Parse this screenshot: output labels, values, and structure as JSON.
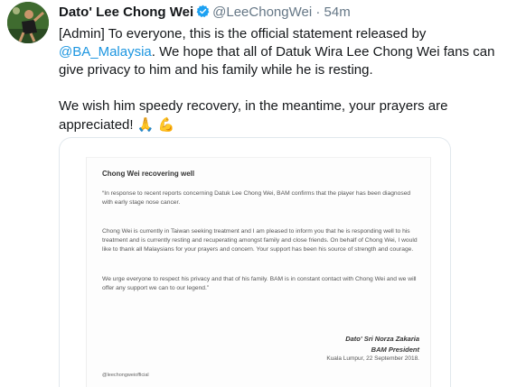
{
  "tweet": {
    "author": {
      "name": "Dato' Lee Chong Wei",
      "handle": "@LeeChongWei",
      "separator": "·",
      "time": "54m",
      "verified": true
    },
    "text": {
      "line1_prefix": "[Admin] To everyone, this is the official statement released by ",
      "mention": "@BA_Malaysia",
      "line1_suffix": ". We hope that all of Datuk Wira Lee Chong Wei fans can give privacy to him and his family while he is resting.",
      "line2": "We wish him speedy recovery, in the meantime, your prayers are appreciated!",
      "emoji_pray": "🙏",
      "emoji_muscle": "💪"
    }
  },
  "statement": {
    "title": "Chong Wei recovering well",
    "paragraph1": "“In response to recent reports concerning Datuk Lee Chong Wei, BAM confirms that the player has been diagnosed with early stage nose cancer.",
    "paragraph2": "Chong Wei is currently in Taiwan seeking treatment and I am pleased to inform you that he is responding well to his treatment and is currently resting and recuperating amongst family and close friends. On behalf of Chong Wei, I would like to thank all Malaysians for your prayers and concern. Your support has been his source of strength and courage.",
    "paragraph3": "We urge everyone to respect his privacy and that of his family. BAM is in constant contact with Chong Wei and we will offer any support we can to our legend.”",
    "signatory_name": "Dato' Sri Norza Zakaria",
    "signatory_title": "BAM President",
    "place_date": "Kuala Lumpur, 22 September 2018.",
    "watermark_handle": "@leechongweiofficial"
  },
  "colors": {
    "text": "#14171a",
    "secondary": "#657786",
    "link": "#1b95e0",
    "verified": "#1da1f2",
    "border": "#e1e8ed"
  },
  "icons": {
    "verified": "verified-badge-icon"
  }
}
